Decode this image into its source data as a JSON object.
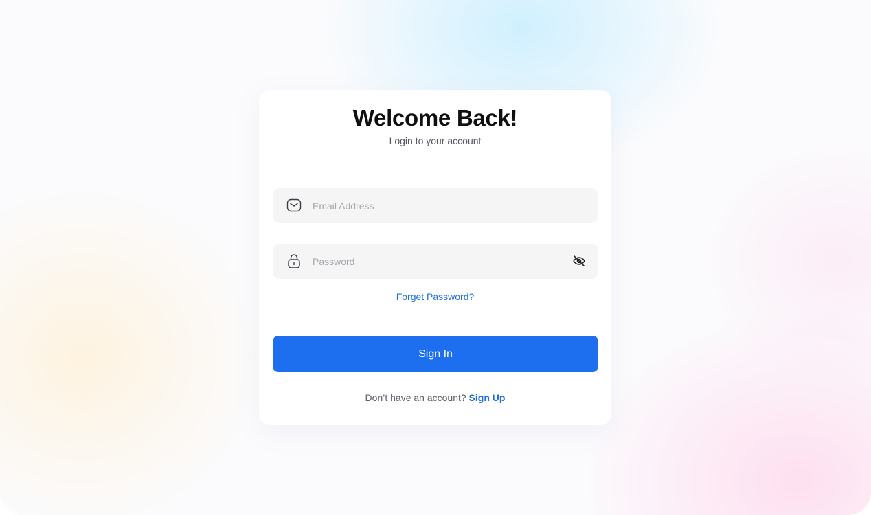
{
  "login": {
    "title": "Welcome Back!",
    "subtitle": "Login to your account",
    "email": {
      "placeholder": "Email Address",
      "value": "",
      "icon": "mail-icon"
    },
    "password": {
      "placeholder": "Password",
      "value": "",
      "icon": "lock-icon",
      "toggle_icon": "eye-off-icon"
    },
    "forgot_label": "Forget Password?",
    "signin_label": "Sign In",
    "signup_prompt": "Don’t have an account?",
    "signup_link": " Sign Up"
  },
  "colors": {
    "accent": "#1e6ff0",
    "link": "#1f6fe0",
    "field_bg": "#f5f5f6"
  }
}
